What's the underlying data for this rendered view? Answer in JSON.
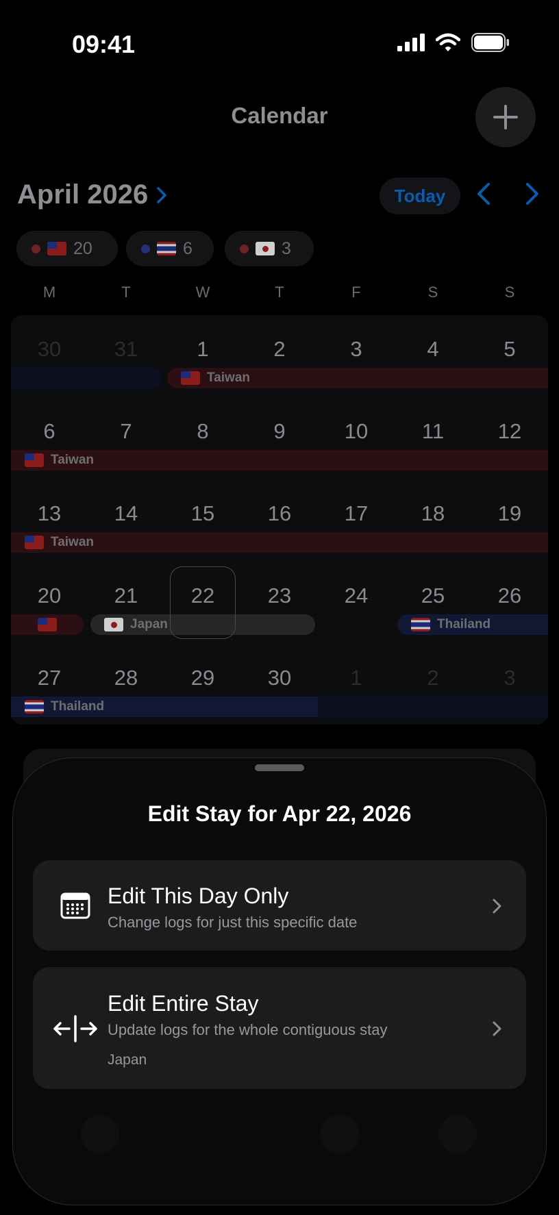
{
  "status_bar": {
    "time": "09:41"
  },
  "header": {
    "title": "Calendar",
    "add_icon": "plus-icon"
  },
  "month_nav": {
    "month_label": "April 2026",
    "today_label": "Today",
    "prev_icon": "chevron-left-icon",
    "next_icon": "chevron-right-icon"
  },
  "country_chips": [
    {
      "flag": "taiwan",
      "dot_color": "#6e2226",
      "count": "20"
    },
    {
      "flag": "thailand",
      "dot_color": "#22307a",
      "count": "6"
    },
    {
      "flag": "japan",
      "dot_color": "#6e2226",
      "count": "3"
    }
  ],
  "weekdays": [
    "M",
    "T",
    "W",
    "T",
    "F",
    "S",
    "S"
  ],
  "weeks": [
    {
      "days": [
        "30",
        "31",
        "1",
        "2",
        "3",
        "4",
        "5"
      ],
      "outside": [
        true,
        true,
        false,
        false,
        false,
        false,
        false
      ]
    },
    {
      "days": [
        "6",
        "7",
        "8",
        "9",
        "10",
        "11",
        "12"
      ],
      "outside": [
        false,
        false,
        false,
        false,
        false,
        false,
        false
      ]
    },
    {
      "days": [
        "13",
        "14",
        "15",
        "16",
        "17",
        "18",
        "19"
      ],
      "outside": [
        false,
        false,
        false,
        false,
        false,
        false,
        false
      ]
    },
    {
      "days": [
        "20",
        "21",
        "22",
        "23",
        "24",
        "25",
        "26"
      ],
      "outside": [
        false,
        false,
        false,
        false,
        false,
        false,
        false
      ]
    },
    {
      "days": [
        "27",
        "28",
        "29",
        "30",
        "1",
        "2",
        "3"
      ],
      "outside": [
        false,
        false,
        false,
        false,
        true,
        true,
        true
      ]
    }
  ],
  "stay_labels": {
    "taiwan": "Taiwan",
    "japan": "Japan",
    "thailand": "Thailand"
  },
  "sheet": {
    "title": "Edit Stay for Apr 22, 2026",
    "options": [
      {
        "title": "Edit This Day Only",
        "subtitle": "Change logs for just this specific date",
        "icon": "calendar-grid-icon"
      },
      {
        "title": "Edit Entire Stay",
        "subtitle": "Update logs for the whole contiguous stay",
        "detail": "Japan",
        "icon": "split-arrows-icon"
      }
    ]
  },
  "colors": {
    "accent": "#0a84ff",
    "taiwan_bar": "#2c0f12",
    "thailand_bar": "#111833",
    "japan_bar": "#262628",
    "sheet_bg": "#0a0a0b",
    "option_bg": "#1c1c1e"
  }
}
